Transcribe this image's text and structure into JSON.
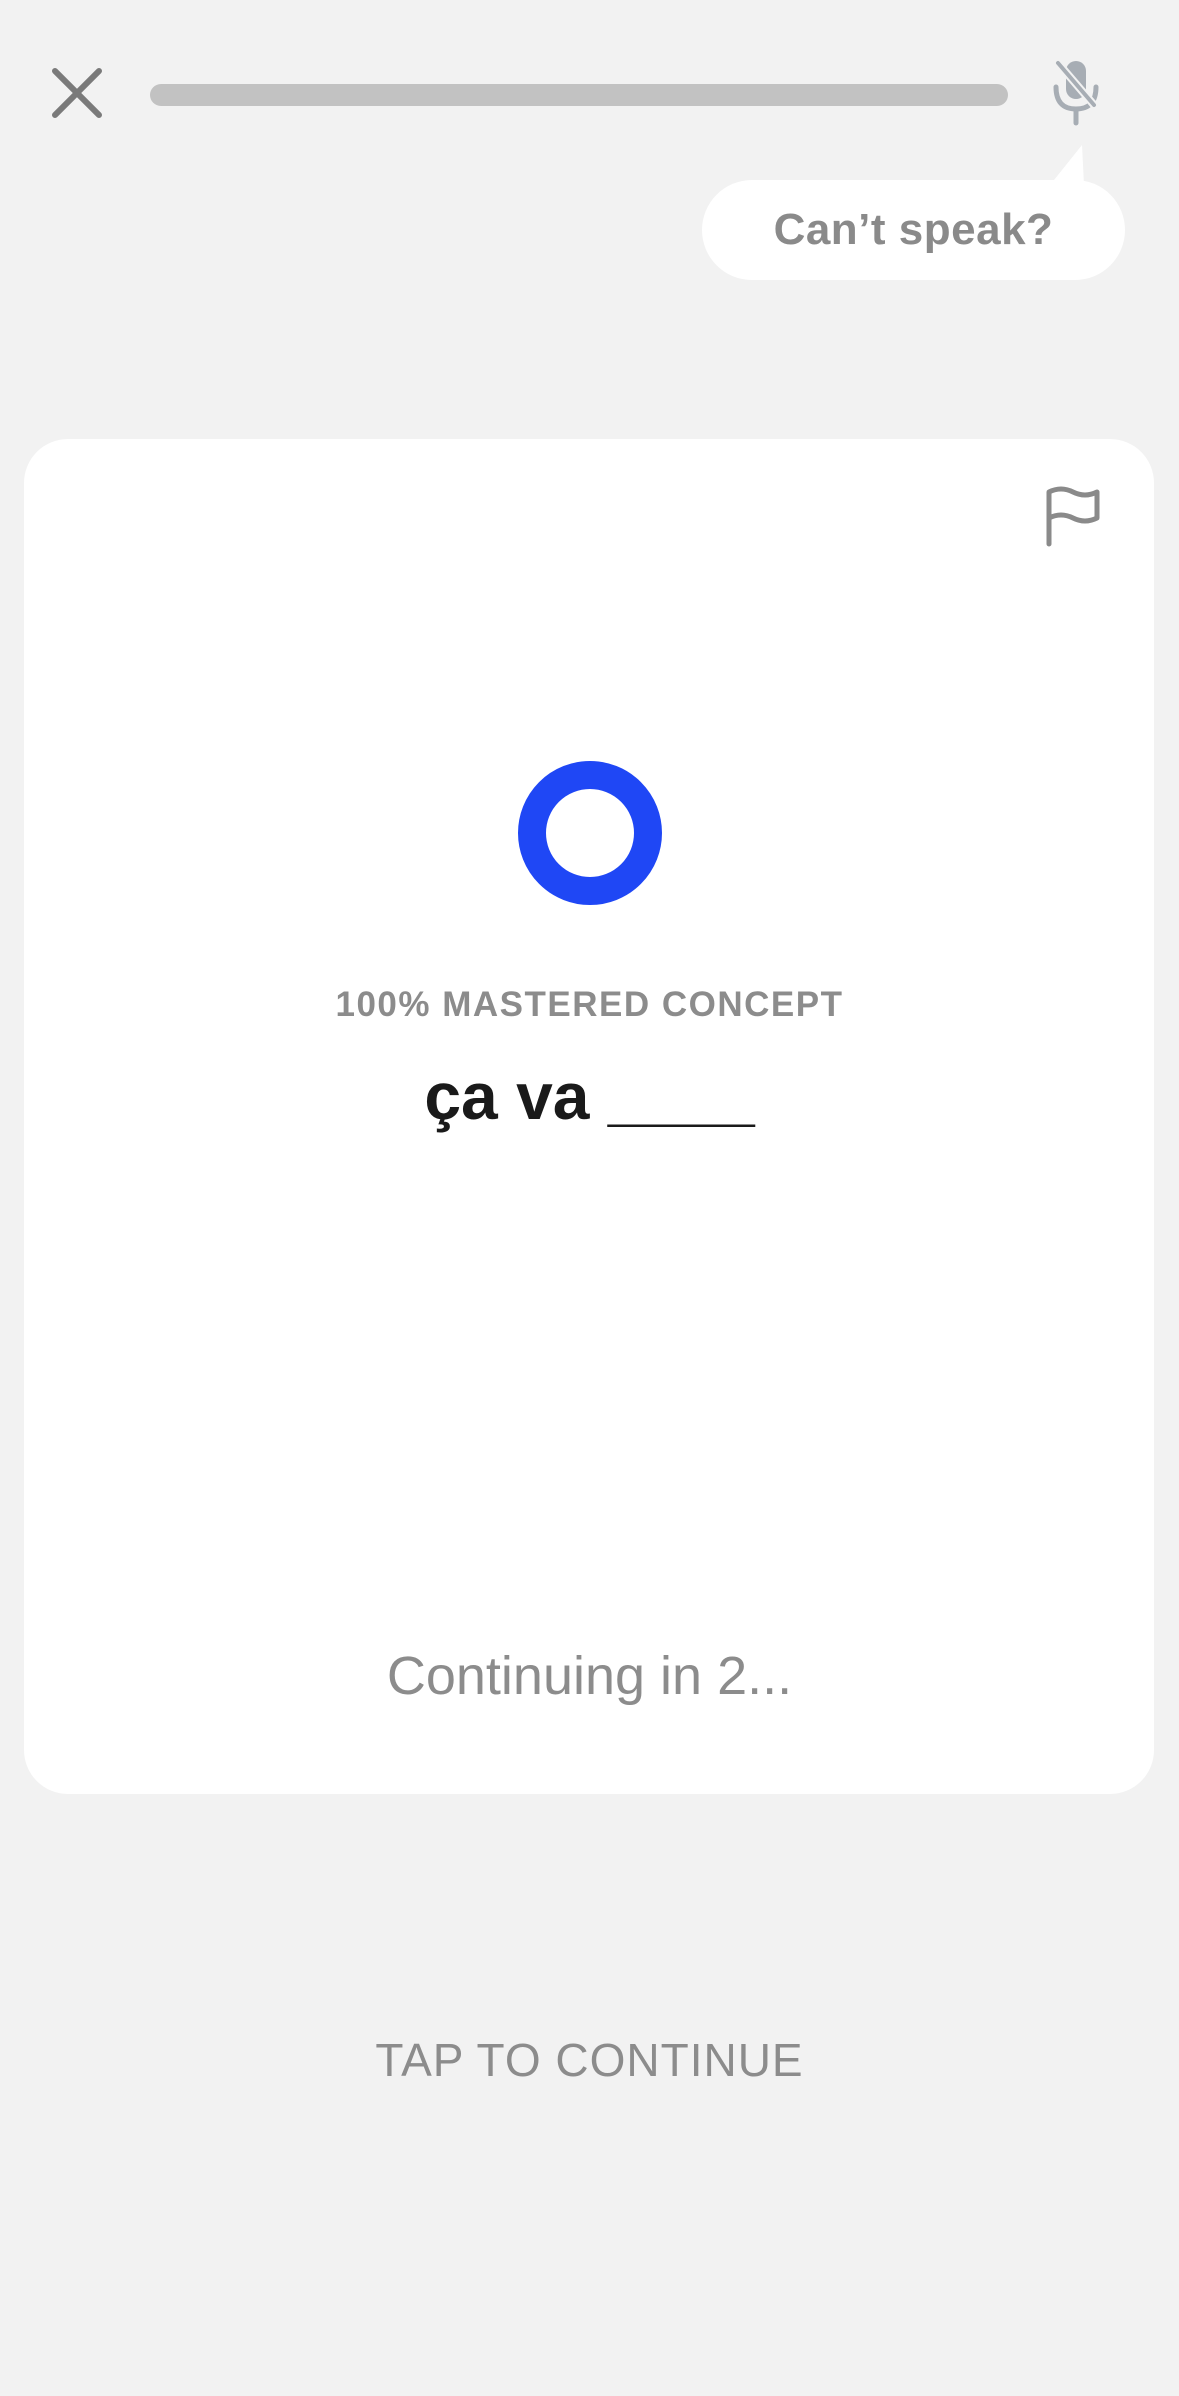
{
  "header": {
    "close_icon": "close-icon",
    "progress": 0.0,
    "mic_icon": "microphone-muted-icon"
  },
  "tooltip": {
    "label": "Can’t speak?"
  },
  "card": {
    "flag_icon": "flag-icon",
    "status_icon": "ring-icon",
    "accent_color": "#1f47f5",
    "mastery_label": "100% MASTERED CONCEPT",
    "phrase": "ça va ____",
    "continuing_text": "Continuing in 2..."
  },
  "footer": {
    "tap_label": "TAP TO CONTINUE"
  }
}
